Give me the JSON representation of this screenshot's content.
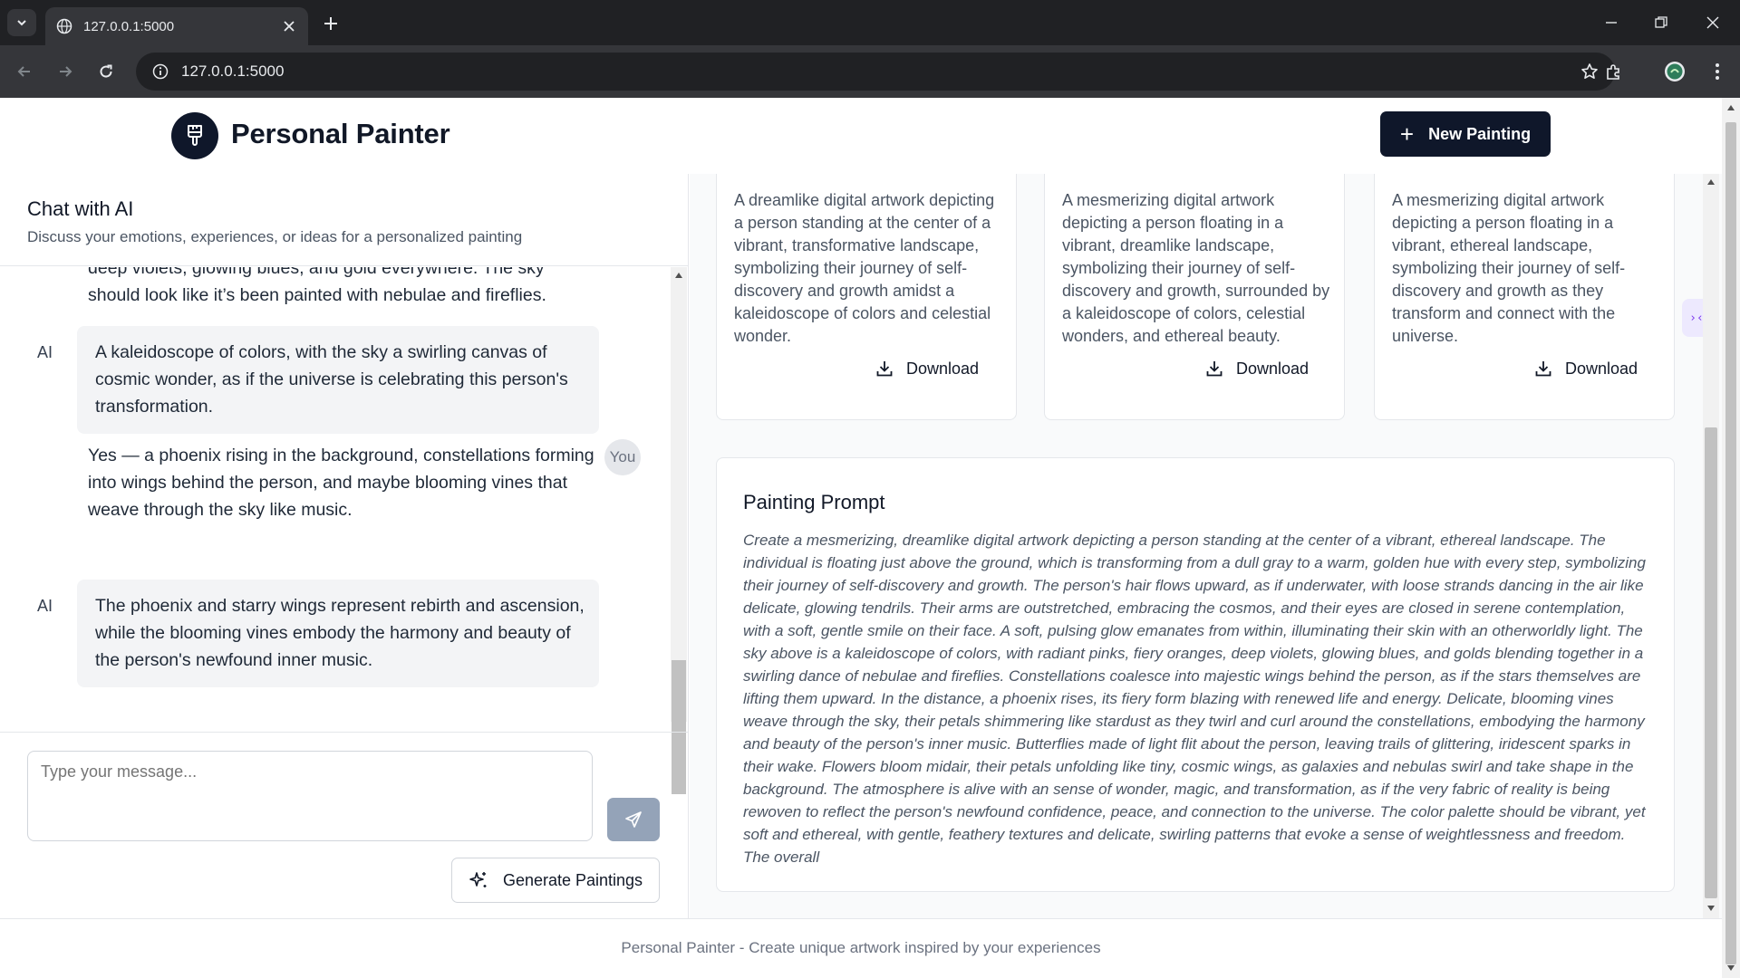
{
  "browser": {
    "tab_title": "127.0.0.1:5000",
    "url": "127.0.0.1:5000"
  },
  "header": {
    "brand": "Personal Painter",
    "new_painting_label": "New Painting"
  },
  "chat": {
    "title": "Chat with AI",
    "subtitle": "Discuss your emotions, experiences, or ideas for a personalized painting",
    "partial_line_1": "deep violets, glowing blues, and gold everywhere. The sky",
    "partial_line_2": "should look like it’s been painted with nebulae and fireflies.",
    "ai_role": "AI",
    "you_role": "You",
    "ai_message_1": "A kaleidoscope of colors, with the sky a swirling canvas of cosmic wonder, as if the universe is celebrating this person's transformation.",
    "user_message_1": "Yes — a phoenix rising in the background, constellations forming into wings behind the person, and maybe blooming vines that weave through the sky like music.",
    "ai_message_2": "The phoenix and starry wings represent rebirth and ascension, while the blooming vines embody the harmony and beauty of the person's newfound inner music.",
    "input_placeholder": "Type your message...",
    "generate_label": "Generate Paintings"
  },
  "cards": [
    {
      "description": "A dreamlike digital artwork depicting a person standing at the center of a vibrant, transformative landscape, symbolizing their journey of self-discovery and growth amidst a kaleidoscope of colors and celestial wonder.",
      "download_label": "Download"
    },
    {
      "description": "A mesmerizing digital artwork depicting a person floating in a vibrant, dreamlike landscape, symbolizing their journey of self-discovery and growth, surrounded by a kaleidoscope of colors, celestial wonders, and ethereal beauty.",
      "download_label": "Download"
    },
    {
      "description": "A mesmerizing digital artwork depicting a person floating in a vibrant, ethereal landscape, symbolizing their journey of self-discovery and growth as they transform and connect with the universe.",
      "download_label": "Download"
    }
  ],
  "prompt": {
    "title": "Painting Prompt",
    "text": "Create a mesmerizing, dreamlike digital artwork depicting a person standing at the center of a vibrant, ethereal landscape. The individual is floating just above the ground, which is transforming from a dull gray to a warm, golden hue with every step, symbolizing their journey of self-discovery and growth. The person's hair flows upward, as if underwater, with loose strands dancing in the air like delicate, glowing tendrils. Their arms are outstretched, embracing the cosmos, and their eyes are closed in serene contemplation, with a soft, gentle smile on their face. A soft, pulsing glow emanates from within, illuminating their skin with an otherworldly light. The sky above is a kaleidoscope of colors, with radiant pinks, fiery oranges, deep violets, glowing blues, and golds blending together in a swirling dance of nebulae and fireflies. Constellations coalesce into majestic wings behind the person, as if the stars themselves are lifting them upward. In the distance, a phoenix rises, its fiery form blazing with renewed life and energy. Delicate, blooming vines weave through the sky, their petals shimmering like stardust as they twirl and curl around the constellations, embodying the harmony and beauty of the person's inner music. Butterflies made of light flit about the person, leaving trails of glittering, iridescent sparks in their wake. Flowers bloom midair, their petals unfolding like tiny, cosmic wings, as galaxies and nebulas swirl and take shape in the background. The atmosphere is alive with an sense of wonder, magic, and transformation, as if the very fabric of reality is being rewoven to reflect the person's newfound confidence, peace, and connection to the universe. The color palette should be vibrant, yet soft and ethereal, with gentle, feathery textures and delicate, swirling patterns that evoke a sense of weightlessness and freedom. The overall"
  },
  "side_tab_glyph": "›‹",
  "footer": {
    "text": "Personal Painter - Create unique artwork inspired by your experiences"
  },
  "icons": {
    "logo": "paintbrush-icon",
    "send": "send-icon",
    "generate": "sparkles-icon",
    "download": "download-icon"
  },
  "colors": {
    "primary": "#0f172a",
    "send_disabled": "#94a3b8",
    "bubble": "#f3f4f6"
  }
}
